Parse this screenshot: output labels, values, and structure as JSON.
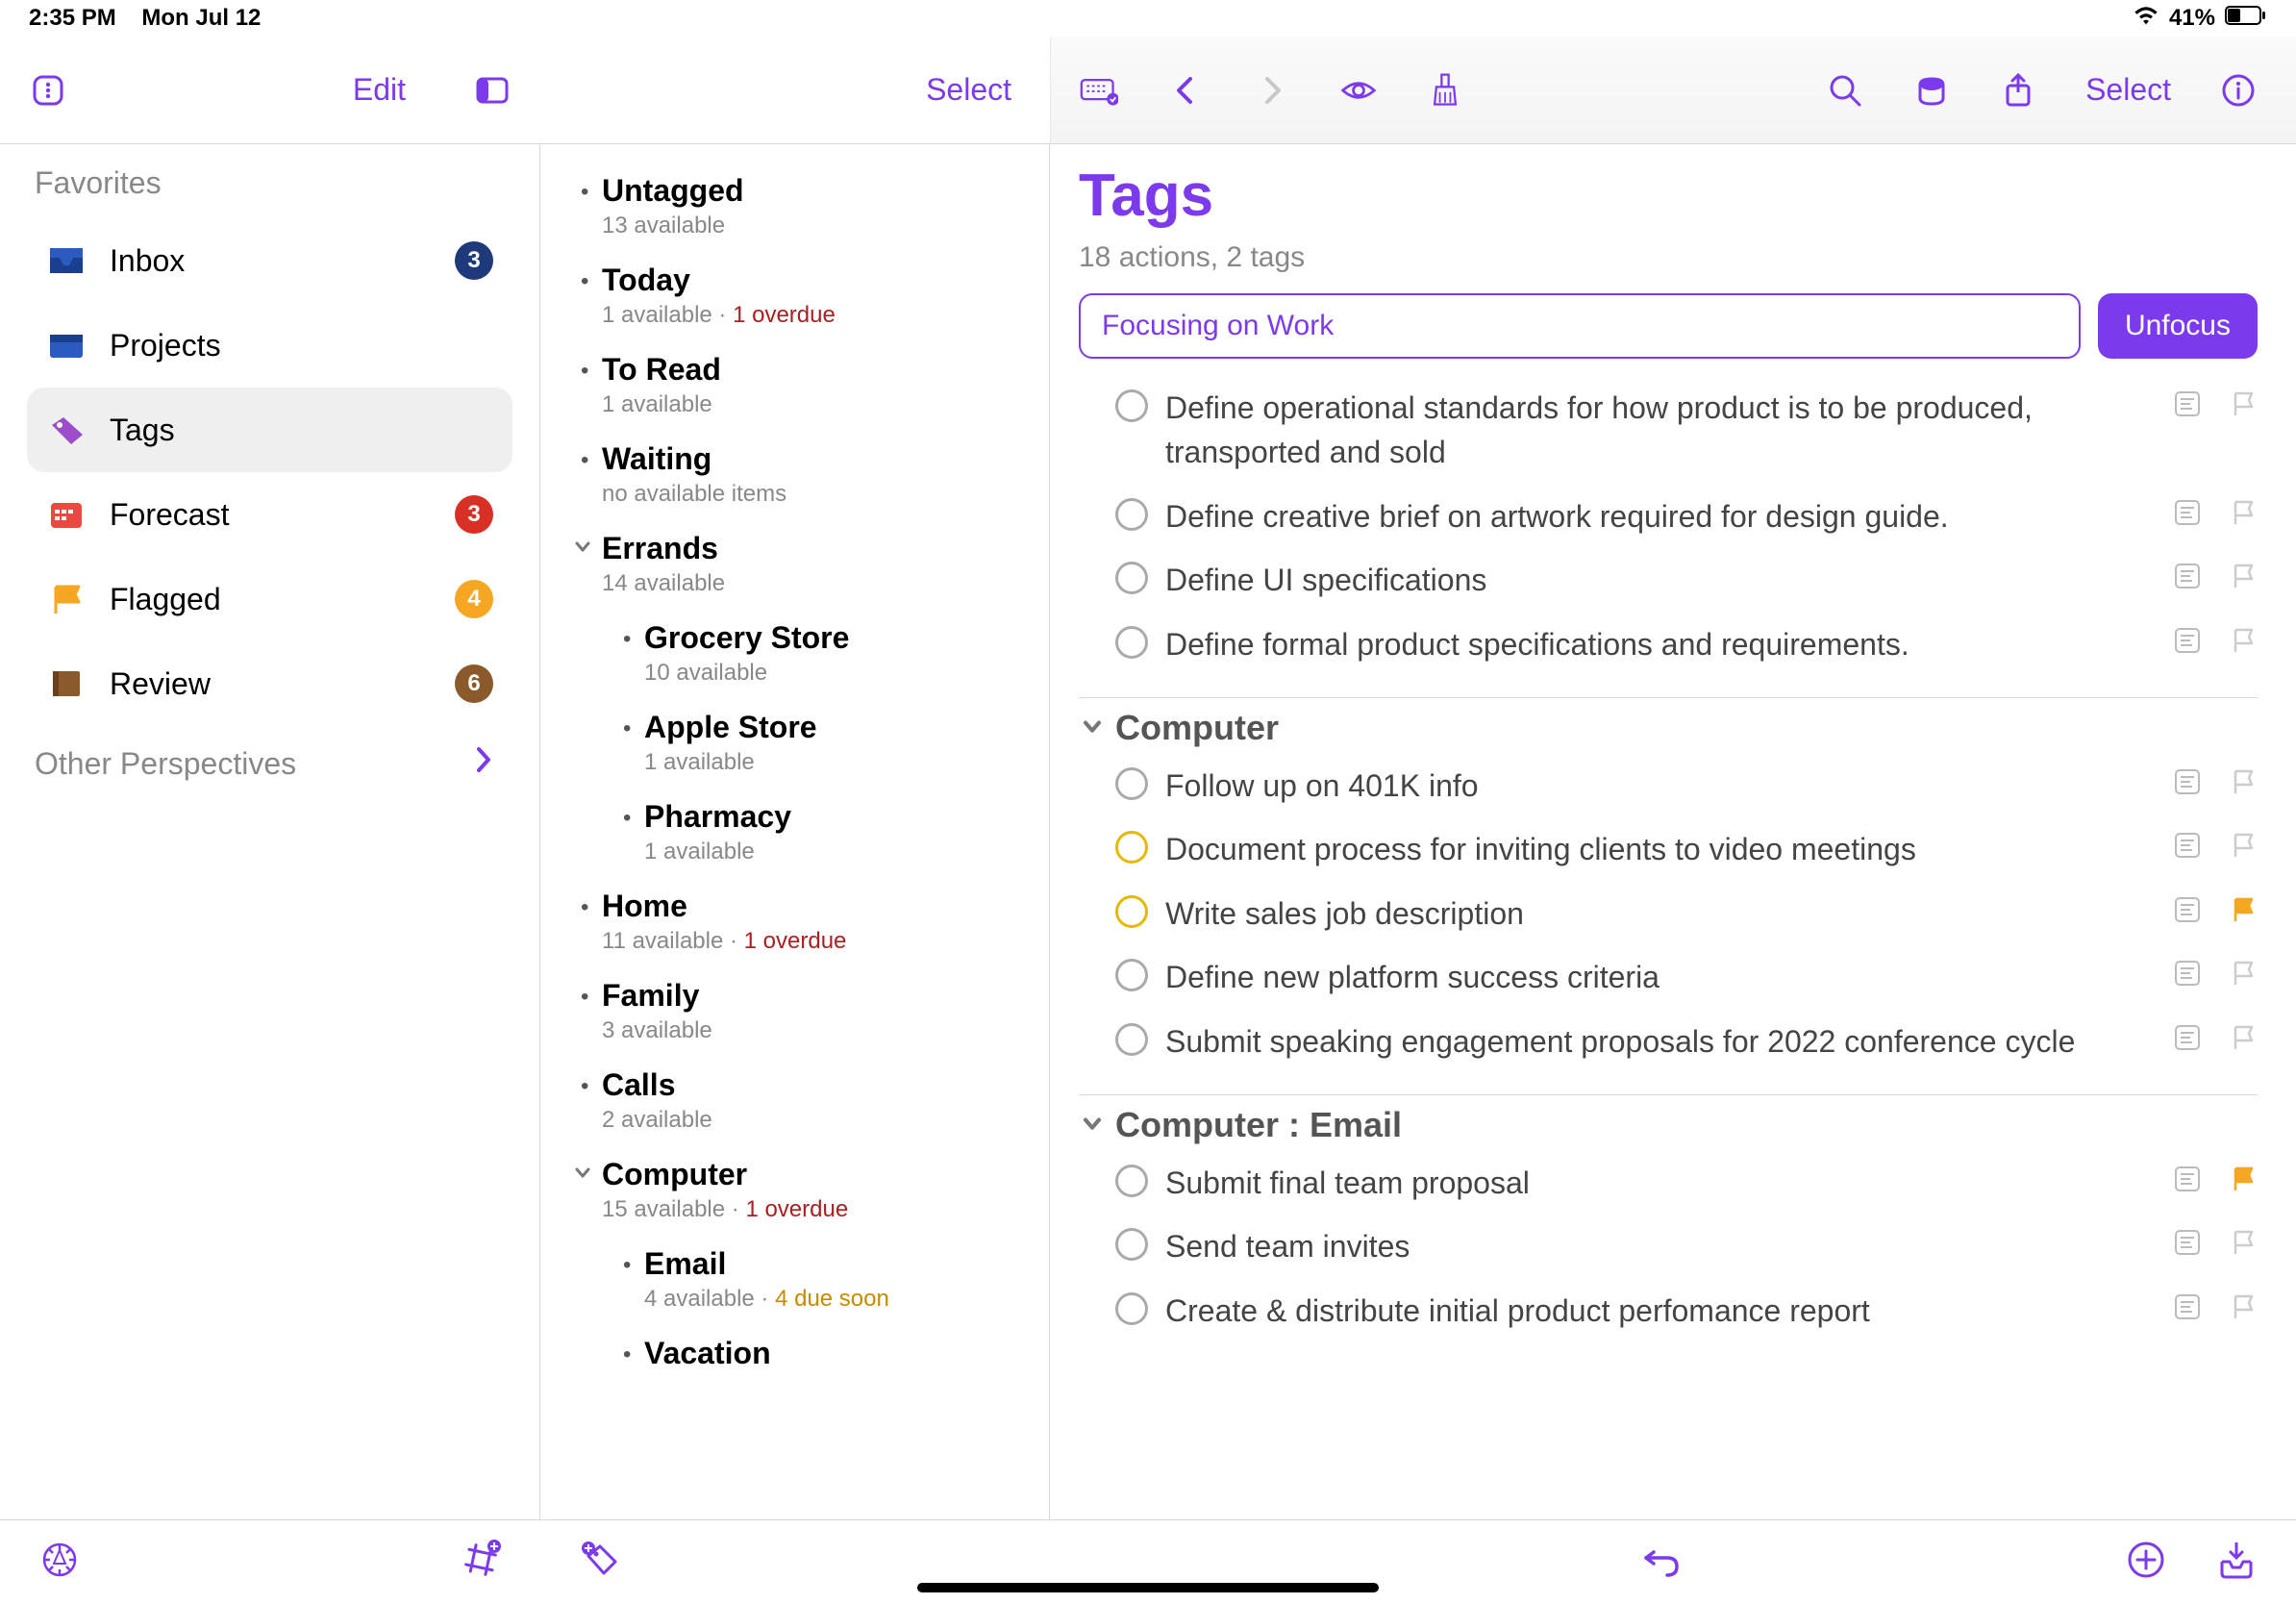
{
  "status": {
    "time": "2:35 PM",
    "date": "Mon Jul 12",
    "battery": "41%"
  },
  "toolbar": {
    "edit_label": "Edit",
    "select_left_label": "Select",
    "select_right_label": "Select"
  },
  "sidebar": {
    "favorites_heading": "Favorites",
    "other_heading": "Other Perspectives",
    "items": [
      {
        "label": "Inbox",
        "badge": "3",
        "badge_color": "#1f3a7a"
      },
      {
        "label": "Projects",
        "badge": "",
        "badge_color": ""
      },
      {
        "label": "Tags",
        "badge": "",
        "badge_color": ""
      },
      {
        "label": "Forecast",
        "badge": "3",
        "badge_color": "#d93025"
      },
      {
        "label": "Flagged",
        "badge": "4",
        "badge_color": "#f5a623"
      },
      {
        "label": "Review",
        "badge": "6",
        "badge_color": "#8b5a2b"
      }
    ]
  },
  "taglist": [
    {
      "title": "Untagged",
      "sub": "13 available",
      "level": 0,
      "expandable": false
    },
    {
      "title": "Today",
      "sub": "1 available",
      "overdue": "1 overdue",
      "level": 0,
      "expandable": false
    },
    {
      "title": "To Read",
      "sub": "1 available",
      "level": 0,
      "expandable": false
    },
    {
      "title": "Waiting",
      "sub": "no available items",
      "level": 0,
      "expandable": false
    },
    {
      "title": "Errands",
      "sub": "14 available",
      "level": 0,
      "expandable": true
    },
    {
      "title": "Grocery Store",
      "sub": "10 available",
      "level": 1,
      "expandable": false
    },
    {
      "title": "Apple Store",
      "sub": "1 available",
      "level": 1,
      "expandable": false
    },
    {
      "title": "Pharmacy",
      "sub": "1 available",
      "level": 1,
      "expandable": false
    },
    {
      "title": "Home",
      "sub": "11 available",
      "overdue": "1 overdue",
      "level": 0,
      "expandable": false
    },
    {
      "title": "Family",
      "sub": "3 available",
      "level": 0,
      "expandable": false
    },
    {
      "title": "Calls",
      "sub": "2 available",
      "level": 0,
      "expandable": false
    },
    {
      "title": "Computer",
      "sub": "15 available",
      "overdue": "1 overdue",
      "level": 0,
      "expandable": true
    },
    {
      "title": "Email",
      "sub": "4 available",
      "due": "4 due soon",
      "level": 1,
      "expandable": false
    },
    {
      "title": "Vacation",
      "sub": "",
      "level": 1,
      "expandable": false
    }
  ],
  "content": {
    "title": "Tags",
    "subtitle": "18 actions, 2 tags",
    "focus_text": "Focusing on Work",
    "unfocus_label": "Unfocus",
    "sections": [
      {
        "header": "",
        "tasks": [
          {
            "text": "Define operational standards for how product is to be produced, transported and sold",
            "due": false,
            "flagged": false
          },
          {
            "text": "Define creative brief on artwork required for design guide.",
            "due": false,
            "flagged": false
          },
          {
            "text": "Define UI specifications",
            "due": false,
            "flagged": false
          },
          {
            "text": "Define formal product specifications and requirements.",
            "due": false,
            "flagged": false
          }
        ]
      },
      {
        "header": "Computer",
        "tasks": [
          {
            "text": "Follow up on 401K info",
            "due": false,
            "flagged": false
          },
          {
            "text": "Document process for inviting clients to video meetings",
            "due": true,
            "flagged": false
          },
          {
            "text": "Write sales job description",
            "due": true,
            "flagged": true
          },
          {
            "text": "Define new platform success criteria",
            "due": false,
            "flagged": false
          },
          {
            "text": "Submit speaking engagement proposals for 2022 conference cycle",
            "due": false,
            "flagged": false
          }
        ]
      },
      {
        "header": "Computer : Email",
        "tasks": [
          {
            "text": "Submit final team proposal",
            "due": false,
            "flagged": true
          },
          {
            "text": "Send team invites",
            "due": false,
            "flagged": false
          },
          {
            "text": "Create & distribute initial product perfomance report",
            "due": false,
            "flagged": false
          }
        ]
      }
    ]
  },
  "colors": {
    "accent": "#7c3aed",
    "overdue": "#a82020",
    "due_soon": "#c78a00",
    "flag": "#f5a623"
  }
}
